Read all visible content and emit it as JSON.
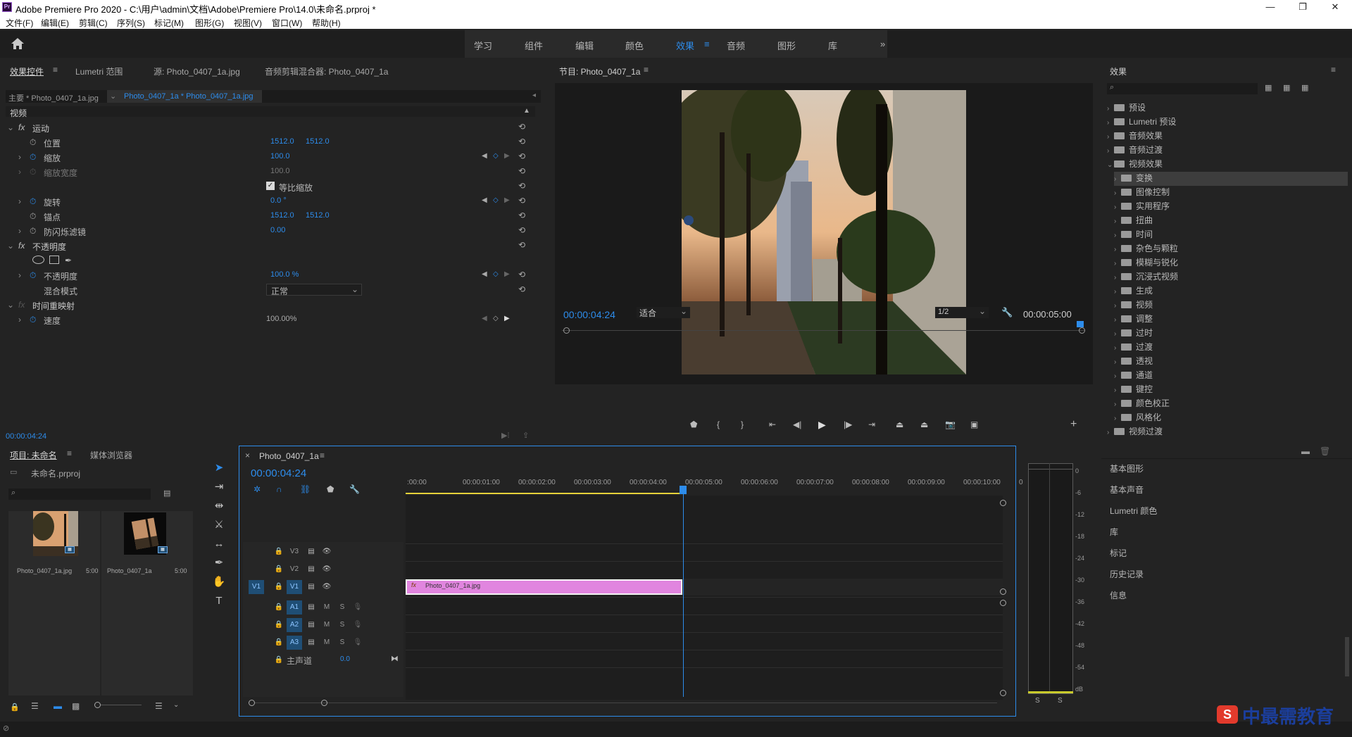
{
  "titlebar": {
    "title": "Adobe Premiere Pro 2020 - C:\\用户\\admin\\文档\\Adobe\\Premiere Pro\\14.0\\未命名.prproj *",
    "logo": "Pr"
  },
  "window_controls": {
    "minimize": "—",
    "maximize": "❐",
    "close": "✕"
  },
  "menu": [
    "文件(F)",
    "编辑(E)",
    "剪辑(C)",
    "序列(S)",
    "标记(M)",
    "图形(G)",
    "视图(V)",
    "窗口(W)",
    "帮助(H)"
  ],
  "workspaces": {
    "tabs": [
      "学习",
      "组件",
      "编辑",
      "颜色",
      "效果",
      "音频",
      "图形",
      "库"
    ],
    "active": "效果",
    "more": "»"
  },
  "effect_controls": {
    "tabs": [
      "效果控件",
      "Lumetri 范围",
      "源: Photo_0407_1a.jpg",
      "音频剪辑混合器: Photo_0407_1a"
    ],
    "master": "主要 * Photo_0407_1a.jpg",
    "clip": "Photo_0407_1a * Photo_0407_1a.jpg",
    "section_video": "视频",
    "rows": {
      "motion": "运动",
      "position": {
        "label": "位置",
        "x": "1512.0",
        "y": "1512.0"
      },
      "scale": {
        "label": "缩放",
        "value": "100.0"
      },
      "scale_width": {
        "label": "缩放宽度",
        "value": "100.0"
      },
      "uniform": "等比缩放",
      "rotation": {
        "label": "旋转",
        "value": "0.0 °"
      },
      "anchor": {
        "label": "锚点",
        "x": "1512.0",
        "y": "1512.0"
      },
      "antiflicker": {
        "label": "防闪烁滤镜",
        "value": "0.00"
      },
      "opacity_group": "不透明度",
      "opacity": {
        "label": "不透明度",
        "value": "100.0 %"
      },
      "blend": {
        "label": "混合模式",
        "value": "正常"
      },
      "time_remap": "时间重映射",
      "speed": {
        "label": "速度",
        "value": "100.00%"
      }
    },
    "timecode": "00:00:04:24",
    "fx": "fx"
  },
  "program_monitor": {
    "title": "节目: Photo_0407_1a",
    "timecode": "00:00:04:24",
    "fit": "适合",
    "resolution": "1/2",
    "duration": "00:00:05:00"
  },
  "effects_panel": {
    "title": "效果",
    "items": [
      "预设",
      "Lumetri 预设",
      "音频效果",
      "音频过渡",
      "视频效果"
    ],
    "video_effects": [
      "变换",
      "图像控制",
      "实用程序",
      "扭曲",
      "时间",
      "杂色与颗粒",
      "模糊与锐化",
      "沉浸式视频",
      "生成",
      "视频",
      "调整",
      "过时",
      "过渡",
      "透视",
      "通道",
      "键控",
      "颜色校正",
      "风格化"
    ],
    "last": "视频过渡",
    "side_panels": [
      "基本图形",
      "基本声音",
      "Lumetri 颜色",
      "库",
      "标记",
      "历史记录",
      "信息"
    ]
  },
  "project": {
    "tabs": [
      "项目: 未命名",
      "媒体浏览器"
    ],
    "file": "未命名.prproj",
    "items": [
      {
        "name": "Photo_0407_1a.jpg",
        "duration": "5:00"
      },
      {
        "name": "Photo_0407_1a",
        "duration": "5:00"
      }
    ]
  },
  "timeline": {
    "tab": "Photo_0407_1a",
    "timecode": "00:00:04:24",
    "ruler": [
      ":00:00",
      "00:00:01:00",
      "00:00:02:00",
      "00:00:03:00",
      "00:00:04:00",
      "00:00:05:00",
      "00:00:06:00",
      "00:00:07:00",
      "00:00:08:00",
      "00:00:09:00",
      "00:00:10:00",
      "0"
    ],
    "tracks_video": [
      "V3",
      "V2",
      "V1"
    ],
    "tracks_audio": [
      "A1",
      "A2",
      "A3"
    ],
    "source_patch": "V1",
    "master": "主声道",
    "master_value": "0.0",
    "clip": "Photo_0407_1a.jpg",
    "playhead_seconds": 4.96,
    "clip_end_seconds": 5
  },
  "audio_meter": {
    "labels": [
      "0",
      "-6",
      "-12",
      "-18",
      "-24",
      "-30",
      "-36",
      "-42",
      "-48",
      "-54",
      "dB"
    ],
    "solo": [
      "S",
      "S"
    ]
  },
  "watermark": "中最需教育",
  "colors": {
    "accent": "#2d8ceb",
    "clip": "#e185df",
    "bg": "#232323"
  }
}
